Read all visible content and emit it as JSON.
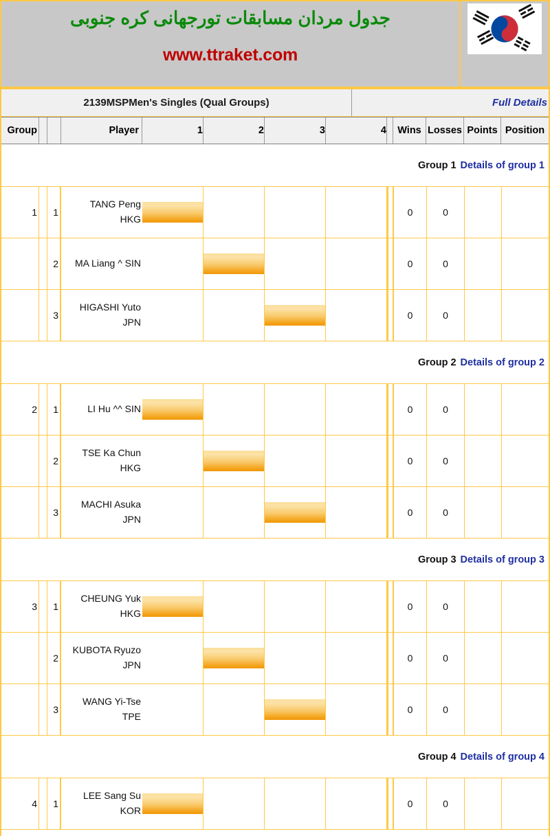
{
  "banner": {
    "title_fa": "جدول مردان مسابقات تورجهانی کره جنوبی",
    "url": "www.ttraket.com",
    "flag_name": "south-korea-flag",
    "flag_colors": {
      "red": "#CD2E3A",
      "blue": "#0047A0",
      "black": "#111111",
      "white": "#FFFFFF"
    }
  },
  "titlebar": {
    "event_title": "2139MSPMen's Singles (Qual Groups)",
    "full_details_label": "Full Details"
  },
  "columns": {
    "group": "Group",
    "spacer": "",
    "rank": "",
    "player": "Player",
    "m1": "1",
    "m2": "2",
    "m3": "3",
    "m4": "4",
    "wins": "Wins",
    "losses": "Losses",
    "points": "Points",
    "position": "Position"
  },
  "groups": [
    {
      "header_label": "Group 1",
      "header_link": "Details of group 1",
      "group_number": "1",
      "rows": [
        {
          "group": "1",
          "rank": "1",
          "name": "TANG Peng",
          "country": "HKG",
          "self_col": 1,
          "m1": "",
          "m2": "",
          "m3": "",
          "m4": "",
          "wins": "0",
          "losses": "0",
          "points": "",
          "position": ""
        },
        {
          "group": "",
          "rank": "2",
          "name": "MA Liang ^ SIN",
          "country": "",
          "self_col": 2,
          "m1": "",
          "m2": "",
          "m3": "",
          "m4": "",
          "wins": "0",
          "losses": "0",
          "points": "",
          "position": ""
        },
        {
          "group": "",
          "rank": "3",
          "name": "HIGASHI Yuto",
          "country": "JPN",
          "self_col": 3,
          "m1": "",
          "m2": "",
          "m3": "",
          "m4": "",
          "wins": "0",
          "losses": "0",
          "points": "",
          "position": ""
        }
      ]
    },
    {
      "header_label": "Group 2",
      "header_link": "Details of group 2",
      "group_number": "2",
      "rows": [
        {
          "group": "2",
          "rank": "1",
          "name": "LI Hu ^^ SIN",
          "country": "",
          "self_col": 1,
          "m1": "",
          "m2": "",
          "m3": "",
          "m4": "",
          "wins": "0",
          "losses": "0",
          "points": "",
          "position": ""
        },
        {
          "group": "",
          "rank": "2",
          "name": "TSE Ka Chun",
          "country": "HKG",
          "self_col": 2,
          "m1": "",
          "m2": "",
          "m3": "",
          "m4": "",
          "wins": "0",
          "losses": "0",
          "points": "",
          "position": ""
        },
        {
          "group": "",
          "rank": "3",
          "name": "MACHI Asuka",
          "country": "JPN",
          "self_col": 3,
          "m1": "",
          "m2": "",
          "m3": "",
          "m4": "",
          "wins": "0",
          "losses": "0",
          "points": "",
          "position": ""
        }
      ]
    },
    {
      "header_label": "Group 3",
      "header_link": "Details of group 3",
      "group_number": "3",
      "rows": [
        {
          "group": "3",
          "rank": "1",
          "name": "CHEUNG Yuk",
          "country": "HKG",
          "self_col": 1,
          "m1": "",
          "m2": "",
          "m3": "",
          "m4": "",
          "wins": "0",
          "losses": "0",
          "points": "",
          "position": ""
        },
        {
          "group": "",
          "rank": "2",
          "name": "KUBOTA Ryuzo",
          "country": "JPN",
          "self_col": 2,
          "m1": "",
          "m2": "",
          "m3": "",
          "m4": "",
          "wins": "0",
          "losses": "0",
          "points": "",
          "position": ""
        },
        {
          "group": "",
          "rank": "3",
          "name": "WANG Yi-Tse",
          "country": "TPE",
          "self_col": 3,
          "m1": "",
          "m2": "",
          "m3": "",
          "m4": "",
          "wins": "0",
          "losses": "0",
          "points": "",
          "position": ""
        }
      ]
    },
    {
      "header_label": "Group 4",
      "header_link": "Details of group 4",
      "group_number": "4",
      "rows": [
        {
          "group": "4",
          "rank": "1",
          "name": "LEE Sang Su",
          "country": "KOR",
          "self_col": 1,
          "m1": "",
          "m2": "",
          "m3": "",
          "m4": "",
          "wins": "0",
          "losses": "0",
          "points": "",
          "position": ""
        }
      ]
    }
  ],
  "theme": {
    "border_orange": "#FFC845",
    "banner_bg": "#C8C8C8",
    "title_green": "#0A8A0A",
    "url_red": "#C00000",
    "link_blue": "#1F2FA0",
    "header_bg": "#F0F0F0"
  }
}
